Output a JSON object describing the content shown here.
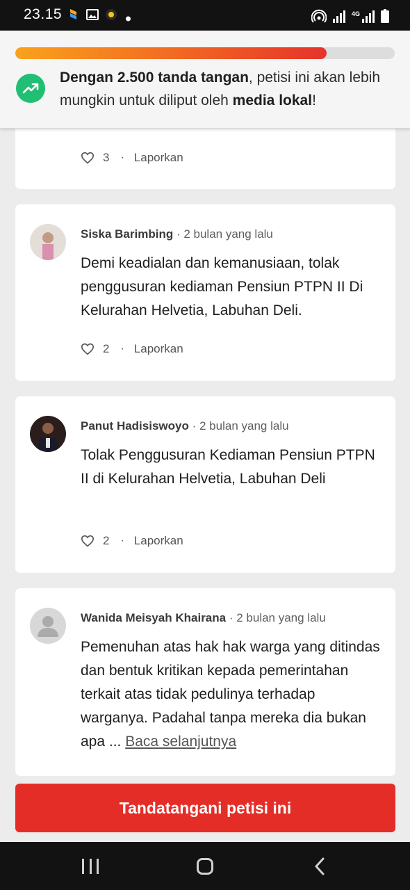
{
  "status_bar": {
    "time": "23.15",
    "network": "4G"
  },
  "progress": {
    "fraction": 0.82,
    "message": {
      "bold1": "Dengan 2.500 tanda tangan",
      "normal": ", petisi ini akan lebih mungkin untuk diliput oleh ",
      "bold2": "media lokal",
      "end": "!"
    },
    "icon": "trending-up-icon"
  },
  "comments": [
    {
      "likes": "3",
      "report_label": "Laporkan"
    },
    {
      "name": "Siska Barimbing",
      "time": "2 bulan yang lalu",
      "text": "Demi keadialan dan kemanusiaan, tolak penggusuran kediaman Pensiun PTPN II Di Kelurahan Helvetia, Labuhan Deli.",
      "likes": "2",
      "report_label": "Laporkan"
    },
    {
      "name": "Panut Hadisiswoyo",
      "time": "2 bulan yang lalu",
      "text": "Tolak Penggusuran Kediaman Pensiun PTPN II di Kelurahan Helvetia, Labuhan Deli",
      "likes": "2",
      "report_label": "Laporkan"
    },
    {
      "name": "Wanida Meisyah Khairana",
      "time": "2 bulan yang lalu",
      "text": "Pemenuhan atas hak hak warga yang ditindas dan bentuk kritikan kepada pemerintahan terkait atas tidak pedulinya terhadap warganya. Padahal tanpa mereka dia bukan apa ... ",
      "read_more": "Baca selanjutnya"
    }
  ],
  "separator": "·",
  "sign_button": "Tandatangani petisi ini",
  "colors": {
    "accent_red": "#e52d27",
    "progress_green": "#21bf73",
    "progress_orange": "#f26b22"
  }
}
